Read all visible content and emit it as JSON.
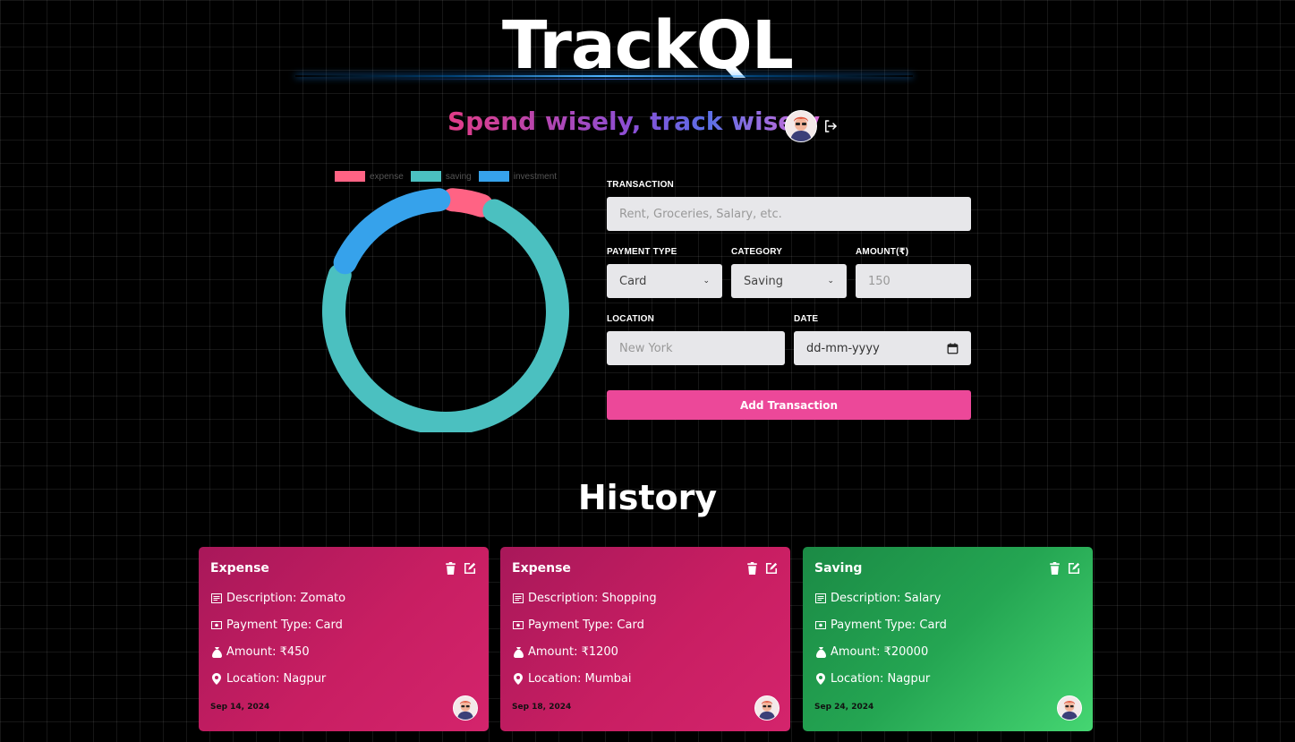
{
  "header": {
    "title": "TrackQL",
    "tagline": "Spend wisely, track wisely"
  },
  "colors": {
    "expense": "#ff6384",
    "saving": "#4bc0c0",
    "investment": "#36a2eb",
    "button": "#ec4899",
    "card_expense": "#c81e62",
    "card_saving": "#24a552"
  },
  "icons": {
    "logout": "logout-icon",
    "user": "avatar",
    "delete": "trash-icon",
    "edit": "edit-icon",
    "description": "document-icon",
    "payment": "money-icon",
    "amount": "money-bag-icon",
    "location": "map-pin-icon"
  },
  "chart_data": {
    "type": "pie",
    "variant": "doughnut",
    "legend_position": "top",
    "categories": [
      "expense",
      "saving",
      "investment"
    ],
    "values": [
      1650,
      20000,
      5000
    ],
    "colors": [
      "#ff6384",
      "#4bc0c0",
      "#36a2eb"
    ]
  },
  "form": {
    "transaction_label": "TRANSACTION",
    "transaction_placeholder": "Rent, Groceries, Salary, etc.",
    "payment_type_label": "PAYMENT TYPE",
    "payment_type_value": "Card",
    "category_label": "CATEGORY",
    "category_value": "Saving",
    "amount_label": "AMOUNT(₹)",
    "amount_placeholder": "150",
    "location_label": "LOCATION",
    "location_placeholder": "New York",
    "date_label": "DATE",
    "date_placeholder": "dd-mm-yyyy",
    "submit_label": "Add Transaction"
  },
  "history": {
    "title": "History",
    "cards": [
      {
        "category": "Expense",
        "description": "Description: Zomato",
        "payment_type": "Payment Type: Card",
        "amount": "Amount: ₹450",
        "location": "Location: Nagpur",
        "date": "Sep 14, 2024"
      },
      {
        "category": "Expense",
        "description": "Description: Shopping",
        "payment_type": "Payment Type: Card",
        "amount": "Amount: ₹1200",
        "location": "Location: Mumbai",
        "date": "Sep 18, 2024"
      },
      {
        "category": "Saving",
        "description": "Description: Salary",
        "payment_type": "Payment Type: Card",
        "amount": "Amount: ₹20000",
        "location": "Location: Nagpur",
        "date": "Sep 24, 2024"
      }
    ]
  }
}
